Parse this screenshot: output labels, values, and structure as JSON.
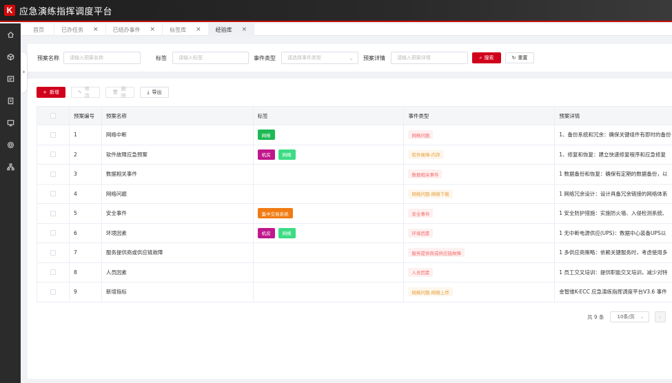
{
  "app": {
    "title": "应急演练指挥调度平台",
    "logo_letter": "K",
    "accent": "#d0021b"
  },
  "sidebar": {
    "icons": [
      "home-icon",
      "cube-icon",
      "document-icon",
      "clipboard-icon",
      "monitor-icon",
      "gear-icon",
      "org-chart-icon"
    ]
  },
  "tabs": [
    {
      "label": "首页",
      "closable": false
    },
    {
      "label": "已办任务",
      "closable": true
    },
    {
      "label": "已结办事件",
      "closable": true
    },
    {
      "label": "标签库",
      "closable": true
    },
    {
      "label": "经验库",
      "closable": true,
      "active": true
    }
  ],
  "search": {
    "plan_name_label": "预案名称",
    "plan_name_placeholder": "请输入预案名称",
    "tag_label": "标签",
    "tag_placeholder": "请输入标签",
    "event_type_label": "事件类型",
    "event_type_placeholder": "请选择事件类型",
    "detail_label": "预案详情",
    "detail_placeholder": "请输入预案详情",
    "search_button": "搜索",
    "reset_button": "重置"
  },
  "toolbar": {
    "add": "新增",
    "edit": "修改",
    "delete": "删除",
    "export": "导出"
  },
  "table": {
    "headers": [
      "预案编号",
      "预案名称",
      "标签",
      "事件类型",
      "预案详情"
    ],
    "rows": [
      {
        "id": "1",
        "name": "网络中断",
        "tags": [
          {
            "label": "网络",
            "color": "#1db954"
          }
        ],
        "event": {
          "label": "网络问题",
          "color": "#f56c6c",
          "bg": "#fef0f0"
        },
        "detail": "1、备份系统和冗余：确保关键组件有即时的备份"
      },
      {
        "id": "2",
        "name": "软件故障应急预案",
        "tags": [
          {
            "label": "机房",
            "color": "#c0188c"
          },
          {
            "label": "网络",
            "color": "#3ddc84"
          }
        ],
        "event": {
          "label": "软件故障-内存",
          "color": "#e6a23c",
          "bg": "#fdf6ec"
        },
        "detail": "1、修复和恢复：建立快速修复程序和应急修复"
      },
      {
        "id": "3",
        "name": "数据相关事件",
        "tags": [],
        "event": {
          "label": "数据相关事件",
          "color": "#f56c6c",
          "bg": "#fef0f0"
        },
        "detail": "1 数据备份和恢复：确保有定期的数据备份，以"
      },
      {
        "id": "4",
        "name": "网络问题",
        "tags": [],
        "event": {
          "label": "网络问题-网络下载",
          "color": "#e6a23c",
          "bg": "#fdf6ec"
        },
        "detail": "1 网络冗余设计：设计具备冗余链接的网络体系"
      },
      {
        "id": "5",
        "name": "安全事件",
        "tags": [
          {
            "label": "集中交易系统",
            "color": "#f07b12"
          }
        ],
        "event": {
          "label": "安全事件",
          "color": "#f56c6c",
          "bg": "#fef0f0"
        },
        "detail": "1 安全防护措施：实施防火墙、入侵检测系统、"
      },
      {
        "id": "6",
        "name": "环境因素",
        "tags": [
          {
            "label": "机房",
            "color": "#c0188c"
          },
          {
            "label": "网络",
            "color": "#3ddc84"
          }
        ],
        "event": {
          "label": "环境因素",
          "color": "#f56c6c",
          "bg": "#fef0f0"
        },
        "detail": "1 无中断电源供应(UPS)：数据中心装备UPS以"
      },
      {
        "id": "7",
        "name": "服务提供商或供应链故障",
        "tags": [],
        "event": {
          "label": "服务提供商或供应链故障",
          "color": "#f56c6c",
          "bg": "#fef0f0"
        },
        "detail": "1 多供应商策略：依赖关键服务时，考虑使用多"
      },
      {
        "id": "8",
        "name": "人员因素",
        "tags": [],
        "event": {
          "label": "人员因素",
          "color": "#f56c6c",
          "bg": "#fef0f0"
        },
        "detail": "1 员工交叉培训：提供职能交叉培训，减少对特"
      },
      {
        "id": "9",
        "name": "新增指标",
        "tags": [],
        "event": {
          "label": "网络问题-网络上传",
          "color": "#e6a23c",
          "bg": "#fdf6ec"
        },
        "detail": "金智维K-ECC 应急演练指挥调度平台V3.6 事件"
      }
    ]
  },
  "pagination": {
    "total": "共 9 条",
    "page_size": "10条/页"
  }
}
